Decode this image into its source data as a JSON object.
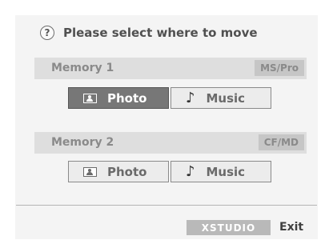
{
  "header": {
    "icon": "help-icon",
    "icon_glyph": "?",
    "title": "Please select where to move"
  },
  "memories": [
    {
      "title": "Memory 1",
      "badge": "MS/Pro",
      "buttons": [
        {
          "icon": "photo-icon",
          "label": "Photo",
          "selected": true
        },
        {
          "icon": "music-icon",
          "label": "Music",
          "selected": false
        }
      ]
    },
    {
      "title": "Memory 2",
      "badge": "CF/MD",
      "buttons": [
        {
          "icon": "photo-icon",
          "label": "Photo",
          "selected": false
        },
        {
          "icon": "music-icon",
          "label": "Music",
          "selected": false
        }
      ]
    }
  ],
  "footer": {
    "xstudio_label": "XSTUDIO",
    "exit_label": "Exit"
  },
  "colors": {
    "selected_button": "#777777",
    "bar": "#dedede",
    "badge": "#c6c6c6"
  }
}
